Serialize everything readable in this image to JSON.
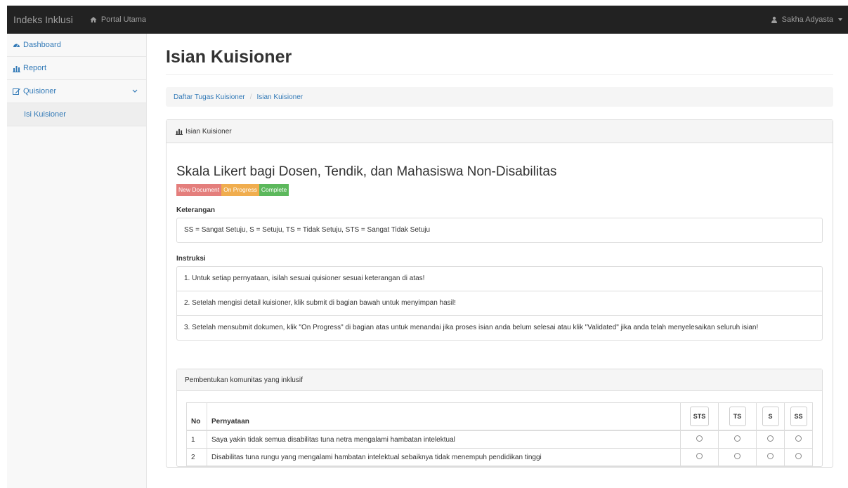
{
  "navbar": {
    "brand": "Indeks Inklusi",
    "portal_link": "Portal Utama",
    "user": "Sakha Adyasta"
  },
  "sidebar": {
    "items": [
      {
        "label": "Dashboard",
        "icon": "dashboard-icon"
      },
      {
        "label": "Report",
        "icon": "bar-chart-icon"
      },
      {
        "label": "Quisioner",
        "icon": "edit-icon"
      },
      {
        "label": "Isi Kuisioner"
      }
    ]
  },
  "page": {
    "title": "Isian Kuisioner",
    "breadcrumb": [
      "Daftar Tugas Kuisioner",
      "Isian Kuisioner"
    ]
  },
  "panel": {
    "heading": "Isian Kuisioner",
    "doc_title": "Skala Likert bagi Dosen, Tendik, dan Mahasiswa Non-Disabilitas",
    "badges": {
      "new": "New Document",
      "progress": "On Progress",
      "complete": "Complete"
    },
    "keterangan_label": "Keterangan",
    "keterangan_text": "SS = Sangat Setuju, S = Setuju, TS = Tidak Setuju, STS = Sangat Tidak Setuju",
    "instruksi_label": "Instruksi",
    "instruksi": [
      "1. Untuk setiap pernyataan, isilah sesuai quisioner sesuai keterangan di atas!",
      "2. Setelah mengisi detail kuisioner, klik submit di bagian bawah untuk menyimpan hasil!",
      "3. Setelah mensubmit dokumen, klik \"On Progress\" di bagian atas untuk menandai jika proses isian anda belum selesai atau klik \"Validated\" jika anda telah menyelesaikan seluruh isian!"
    ]
  },
  "section": {
    "heading": "Pembentukan komunitas yang inklusif",
    "columns": {
      "no": "No",
      "statement": "Pernyataan",
      "sts": "STS",
      "ts": "TS",
      "s": "S",
      "ss": "SS"
    },
    "rows": [
      {
        "no": "1",
        "text": "Saya yakin tidak semua disabilitas tuna netra mengalami hambatan intelektual"
      },
      {
        "no": "2",
        "text": "Disabilitas tuna rungu yang mengalami hambatan intelektual sebaiknya tidak menempuh pendidikan tinggi"
      }
    ]
  }
}
